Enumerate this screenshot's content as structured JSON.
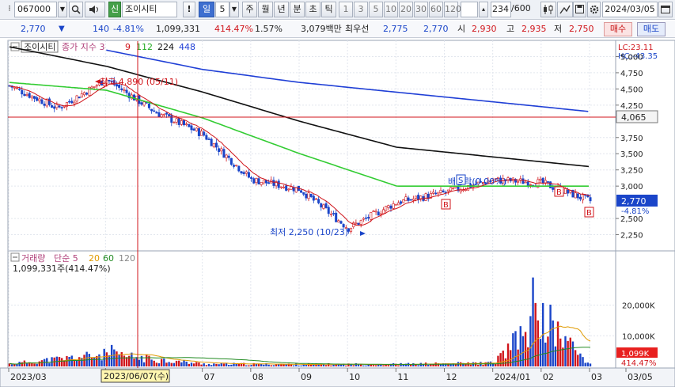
{
  "toolbar": {
    "code": "067000",
    "search_icon": "magnifier-icon",
    "sound_icon": "speaker-icon",
    "market_badge": "신",
    "stock_name": "조이시티",
    "alert": "!",
    "period_selected": "일",
    "period_num": "5",
    "periods": [
      "주",
      "월",
      "년",
      "분",
      "초",
      "틱"
    ],
    "intervals": [
      "1",
      "3",
      "5",
      "10",
      "20",
      "30",
      "60",
      "120"
    ],
    "count": "234",
    "total": "/600",
    "date": "2024/03/05"
  },
  "quote": {
    "price": "2,770",
    "change": "140",
    "change_pct": "-4.81%",
    "volume": "1,099,331",
    "volume_ratio": "414.47%",
    "turnover": "1.57%",
    "amount": "3,079백만",
    "best_label": "최우선",
    "best_ask": "2,775",
    "best_bid": "2,770",
    "open_label": "시",
    "open": "2,930",
    "high_label": "고",
    "high": "2,935",
    "low_label": "저",
    "low": "2,750",
    "buy_label": "매수",
    "sell_label": "매도"
  },
  "price_legend": {
    "name": "조이시티",
    "label": "종가 지수 3",
    "ma": [
      "9",
      "112",
      "224",
      "448"
    ]
  },
  "volume_legend": {
    "label": "거래량",
    "ma_label": "단순 5",
    "ma": [
      "20",
      "60",
      "120"
    ],
    "value": "1,099,331주(414.47%)"
  },
  "right_info": {
    "lc": "LC:23.11",
    "hc": "HC:-43.35"
  },
  "annotations": {
    "high": "최고 4,890 (05/11)",
    "low": "최저 2,250 (10/23)",
    "rights": "배당락(0.00%)",
    "s_marker": "S",
    "b_marker": "B"
  },
  "crosshair": {
    "price": "4,065",
    "date": "2023/06/07(수)"
  },
  "current": {
    "price": "2,770",
    "pct": "-4.81%",
    "volume": "1,099K",
    "volume_pct": "414.47%"
  },
  "colors": {
    "up": "#d0151b",
    "down": "#1a45c9",
    "ma9": "#d0151b",
    "ma112": "#33cc33",
    "ma224": "#111111",
    "ma448": "#1f3fd6",
    "ma20": "#e09a00",
    "ma60": "#228b22",
    "ma120": "#888888"
  },
  "chart_data": {
    "type": "line",
    "title": "",
    "price_axis": [
      "5,000",
      "4,750",
      "4,500",
      "4,250",
      "3,750",
      "3,500",
      "3,250",
      "3,000",
      "2,500",
      "2,250"
    ],
    "volume_axis": [
      "20,000K",
      "10,000K"
    ],
    "ylim": [
      2000,
      5250
    ],
    "x_labels": [
      "2023/03",
      "05",
      "07",
      "08",
      "09",
      "10",
      "11",
      "12",
      "2024/01",
      "02",
      "03",
      "03/05"
    ],
    "series": [
      {
        "name": "종가",
        "x": [
          "2023/03",
          "2023/04",
          "2023/05",
          "2023/06",
          "2023/07",
          "2023/08",
          "2023/09",
          "2023/10",
          "2023/11",
          "2023/12",
          "2024/01",
          "2024/02",
          "2024/03"
        ],
        "values": [
          4550,
          4200,
          4650,
          4150,
          3800,
          3100,
          2950,
          2350,
          2750,
          2900,
          3100,
          3050,
          2770
        ]
      },
      {
        "name": "112",
        "x": [
          "2023/03",
          "2023/05",
          "2023/07",
          "2023/09",
          "2023/11",
          "2024/01",
          "2024/03"
        ],
        "values": [
          4600,
          4480,
          4050,
          3500,
          3000,
          3000,
          3000
        ]
      },
      {
        "name": "224",
        "x": [
          "2023/03",
          "2023/05",
          "2023/07",
          "2023/09",
          "2023/11",
          "2024/01",
          "2024/03"
        ],
        "values": [
          5150,
          4850,
          4450,
          4000,
          3600,
          3450,
          3300
        ]
      },
      {
        "name": "448",
        "x": [
          "2023/05",
          "2023/07",
          "2023/09",
          "2023/11",
          "2024/01",
          "2024/03"
        ],
        "values": [
          5100,
          4800,
          4600,
          4450,
          4300,
          4150
        ]
      }
    ],
    "volume": {
      "x": [
        "2023/03",
        "2023/05",
        "2023/07",
        "2023/09",
        "2023/11",
        "2024/01",
        "2024/02",
        "2024/03"
      ],
      "values": [
        1500,
        7000,
        1500,
        1200,
        1300,
        2000,
        29000,
        1099
      ]
    }
  }
}
